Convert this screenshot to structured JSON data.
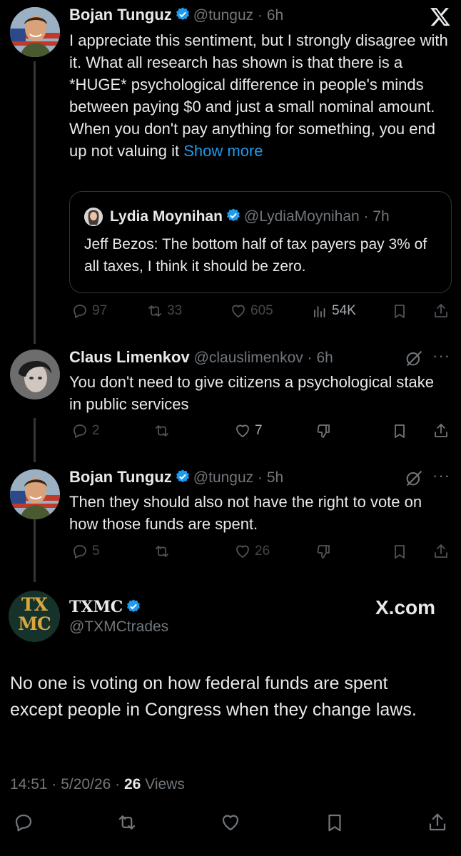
{
  "top_icon": "x-logo-icon",
  "thread": [
    {
      "name": "Bojan Tunguz",
      "handle": "@tunguz",
      "time": "6h",
      "text": "I appreciate this sentiment, but I strongly disagree with it. What all research has shown is that there is a *HUGE* psychological difference in people's minds between paying $0 and just a small nominal amount. When you don't pay anything for something, you end up not valuing",
      "text_tail": "it",
      "show_more": "Show more",
      "quote": {
        "name": "Lydia Moynihan",
        "handle": "@LydiaMoynihan",
        "time": "7h",
        "text": "Jeff Bezos: The bottom half of tax payers pay 3% of all taxes, I think it should be zero."
      },
      "stats": {
        "replies": "97",
        "reposts": "33",
        "likes": "605",
        "views": "54K"
      }
    },
    {
      "name": "Claus Limenkov",
      "handle": "@clauslimenkov",
      "time": "6h",
      "text": "You don't need to give citizens a psychological stake in public services",
      "stats": {
        "replies": "2",
        "reposts": "",
        "likes": "7"
      }
    },
    {
      "name": "Bojan Tunguz",
      "handle": "@tunguz",
      "time": "5h",
      "text": "Then they should also not have the right to vote on how those funds are spent.",
      "stats": {
        "replies": "5",
        "reposts": "",
        "likes": "26"
      }
    }
  ],
  "main": {
    "avatar_text": "TX MC",
    "name": "TXMC",
    "handle": "@TXMCtrades",
    "brand": "X.com",
    "text": "No one is voting on how federal funds are spent except people in Congress when they change laws.",
    "time": "14:51",
    "date": "5/20/26",
    "views_count": "26",
    "views_label": "Views"
  },
  "colors": {
    "bg": "#000000",
    "text": "#e7e9ea",
    "muted": "#71767b",
    "accent": "#1d9bf0",
    "border": "#2f3336"
  }
}
